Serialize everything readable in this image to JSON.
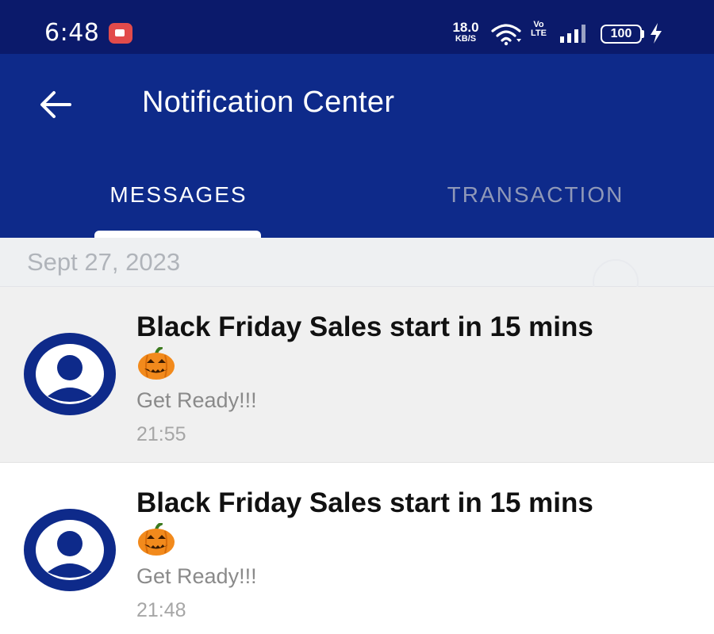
{
  "status_bar": {
    "time": "6:48",
    "net_speed_value": "18.0",
    "net_speed_unit": "KB/S",
    "volte_top": "Vo",
    "volte_bottom": "LTE",
    "battery_level": "100",
    "icons": [
      "screen-record-icon",
      "wifi-icon",
      "volte-icon",
      "signal-icon",
      "battery-icon",
      "charging-bolt-icon"
    ]
  },
  "app_bar": {
    "title": "Notification Center",
    "back_icon": "arrow-left-icon"
  },
  "tabs": [
    {
      "label": "MESSAGES",
      "active": true
    },
    {
      "label": "TRANSACTION",
      "active": false
    }
  ],
  "date_header": "Sept 27, 2023",
  "messages": [
    {
      "title": "Black Friday Sales start in 15 mins",
      "emoji": "jack-o-lantern-icon",
      "body": "Get Ready!!!",
      "time": "21:55",
      "avatar": "user-avatar-icon"
    },
    {
      "title": "Black Friday Sales start in 15 mins",
      "emoji": "jack-o-lantern-icon",
      "body": "Get Ready!!!",
      "time": "21:48",
      "avatar": "user-avatar-icon"
    }
  ],
  "colors": {
    "status_bar": "#0b1a6b",
    "primary": "#0e2a8a",
    "inactive_tab": "#8f98b8",
    "date_header_bg": "#eef0f2",
    "unread_row_bg": "#f0f0f0",
    "avatar": "#0e2a8a"
  }
}
